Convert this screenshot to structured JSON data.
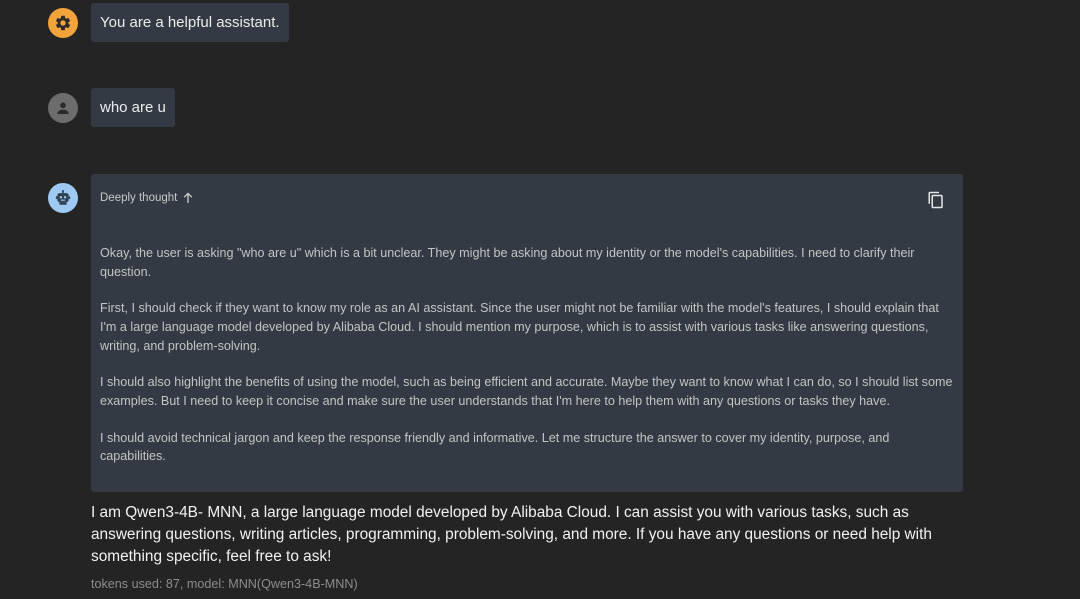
{
  "messages": {
    "system": {
      "role": "system",
      "icon": "gear-icon",
      "text": "You are a helpful assistant."
    },
    "user": {
      "role": "user",
      "icon": "person-icon",
      "text": "who are u"
    },
    "assistant": {
      "role": "assistant",
      "icon": "robot-icon",
      "thinking": {
        "label": "Deeply thought",
        "toggle_icon": "arrow-up-icon",
        "copy_icon": "copy-icon",
        "paragraphs": [
          "Okay, the user is asking \"who are u\" which is a bit unclear. They might be asking about my identity or the model's capabilities. I need to clarify their question.",
          "First, I should check if they want to know my role as an AI assistant. Since the user might not be familiar with the model's features, I should explain that I'm a large language model developed by Alibaba Cloud. I should mention my purpose, which is to assist with various tasks like answering questions, writing, and problem-solving.",
          "I should also highlight the benefits of using the model, such as being efficient and accurate. Maybe they want to know what I can do, so I should list some examples. But I need to keep it concise and make sure the user understands that I'm here to help them with any questions or tasks they have.",
          "I should avoid technical jargon and keep the response friendly and informative. Let me structure the answer to cover my identity, purpose, and capabilities."
        ]
      },
      "answer": "I am Qwen3-4B- MNN, a large language model developed by Alibaba Cloud. I can assist you with various tasks, such as answering questions, writing articles, programming, problem-solving, and more. If you have any questions or need help with something specific, feel free to ask!",
      "meta": "tokens used: 87, model: MNN(Qwen3-4B-MNN)"
    }
  },
  "colors": {
    "background": "#242424",
    "bubble": "#343a43",
    "system_avatar": "#f2a33a",
    "user_avatar": "#6c6c6c",
    "bot_avatar": "#9ec9f2"
  }
}
